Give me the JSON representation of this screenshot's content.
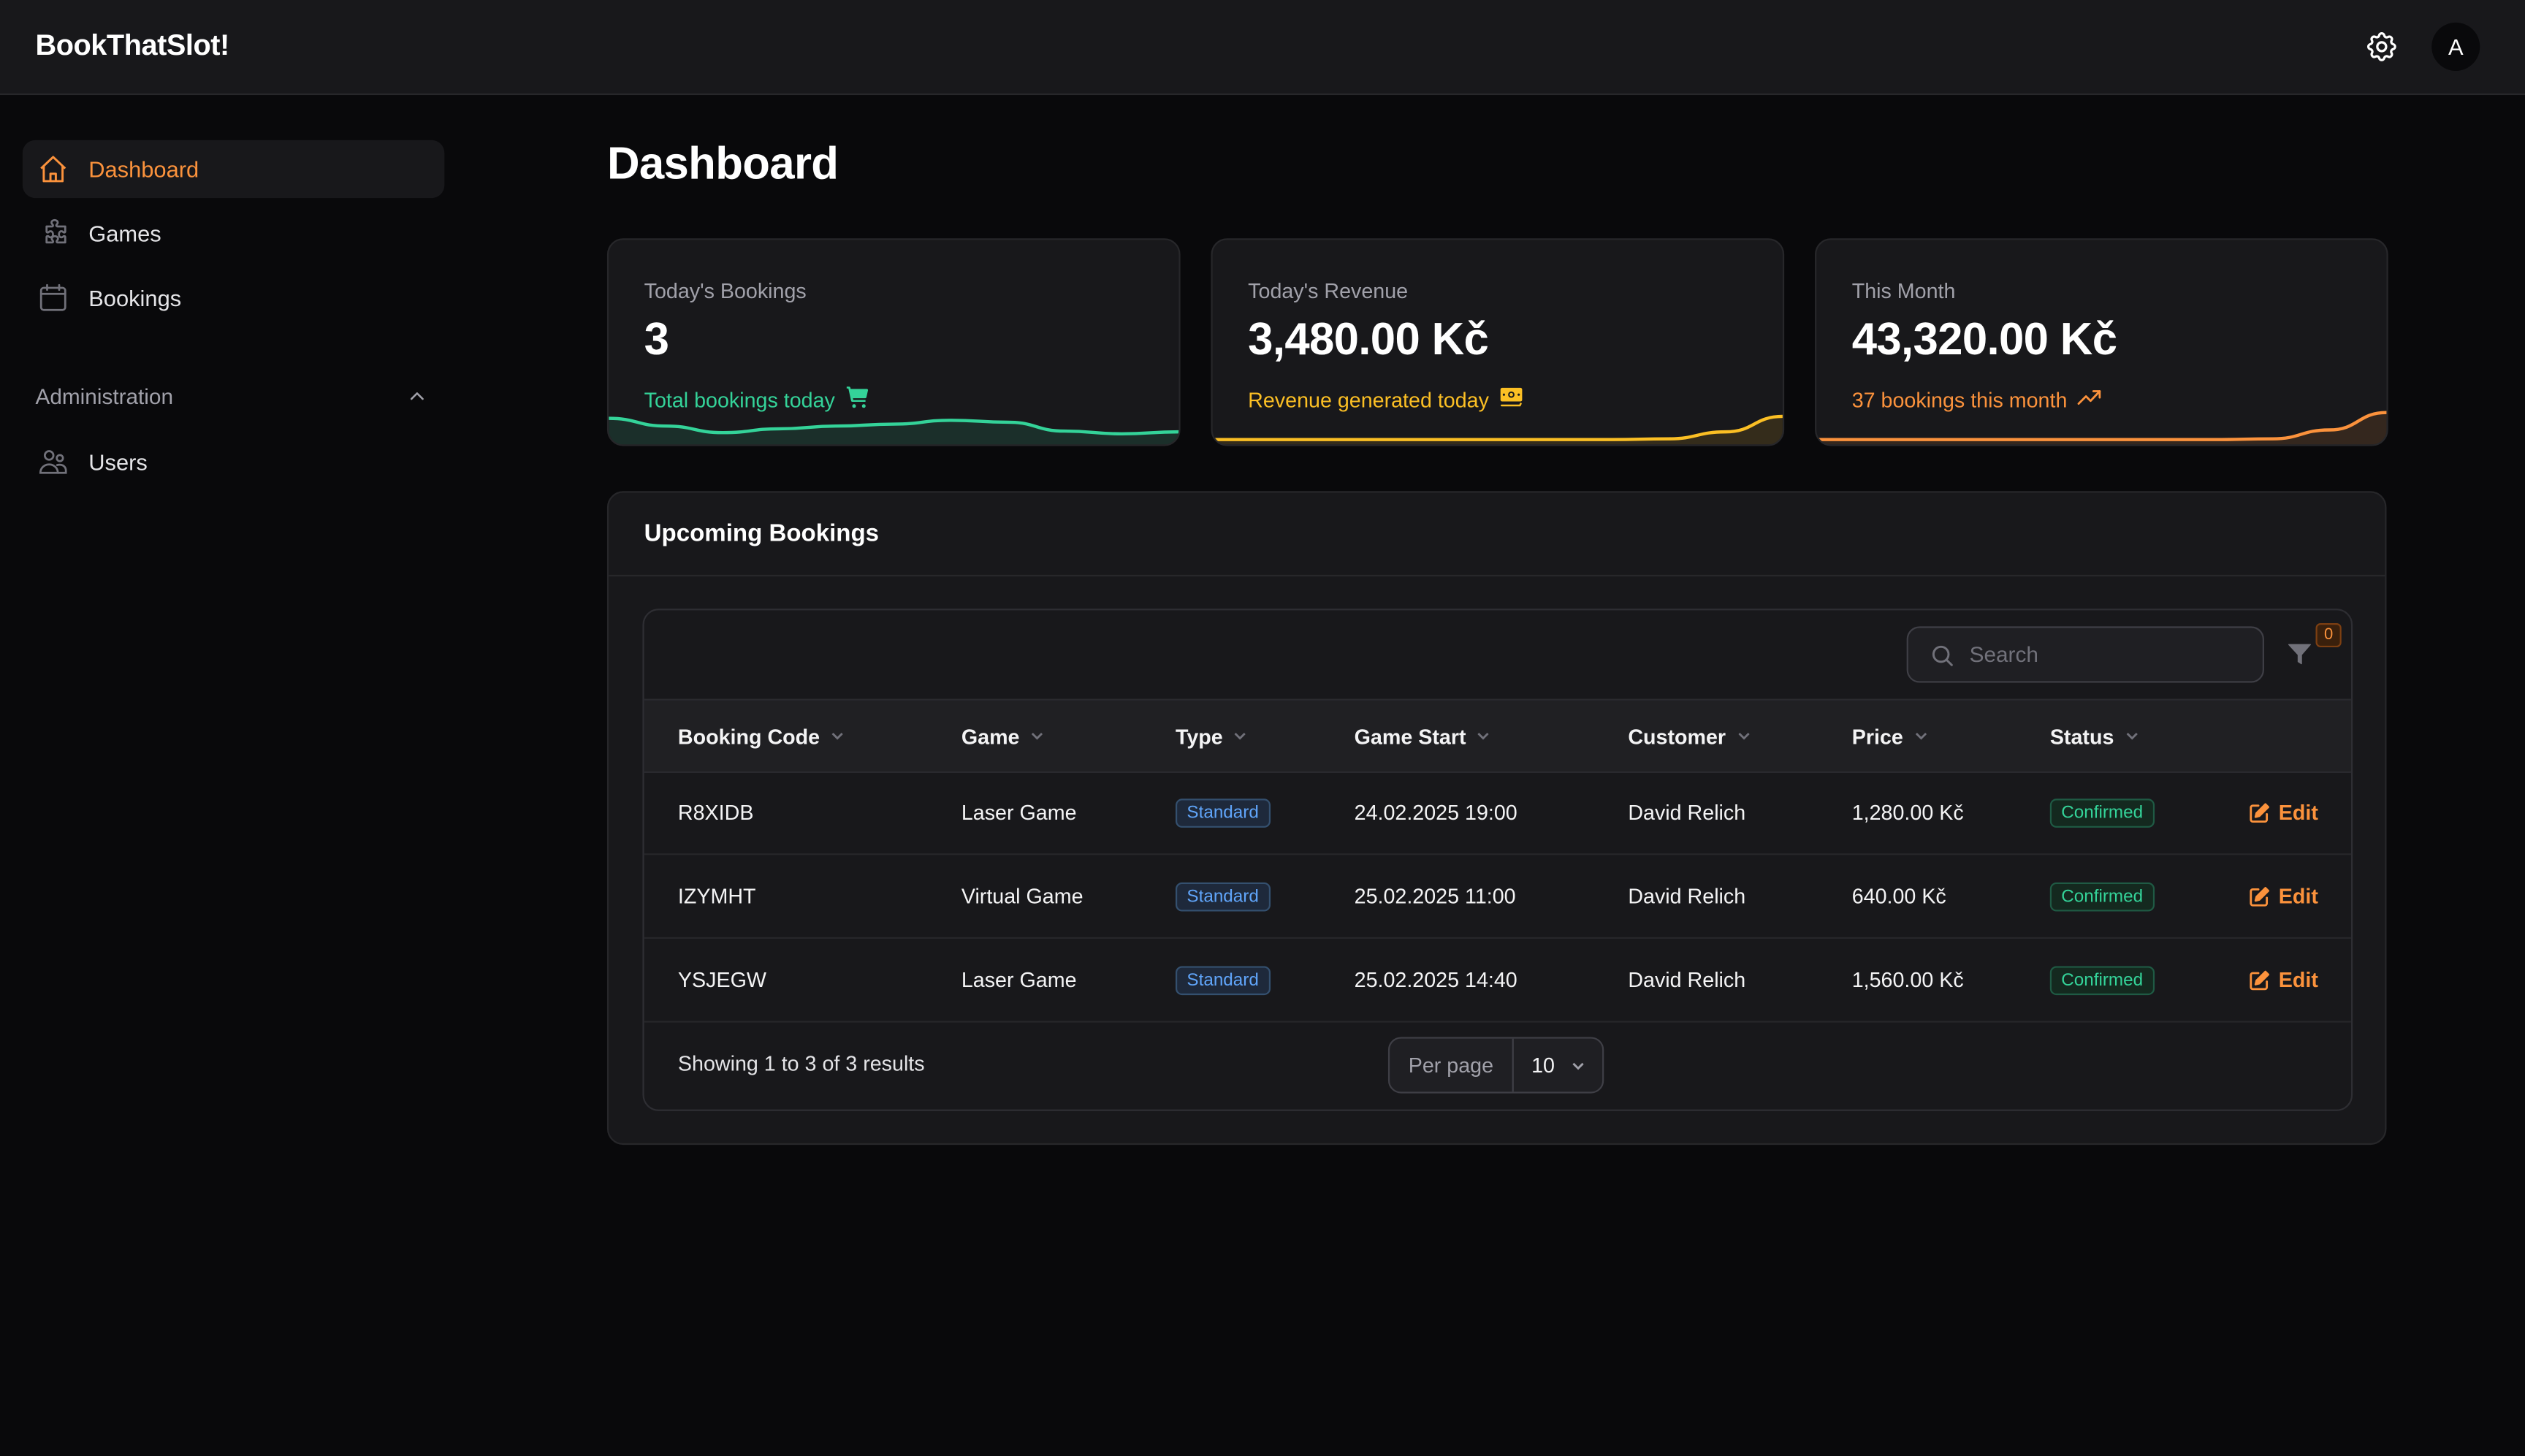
{
  "app": {
    "title": "BookThatSlot!",
    "settings_icon": "gear-icon",
    "avatar_initial": "A"
  },
  "sidebar": {
    "items": [
      {
        "label": "Dashboard",
        "icon": "home-icon",
        "active": true
      },
      {
        "label": "Games",
        "icon": "puzzle-icon",
        "active": false
      },
      {
        "label": "Bookings",
        "icon": "calendar-icon",
        "active": false
      }
    ],
    "section": {
      "label": "Administration",
      "expanded": true,
      "items": [
        {
          "label": "Users",
          "icon": "users-icon"
        }
      ]
    }
  },
  "page": {
    "title": "Dashboard"
  },
  "stats": [
    {
      "label": "Today's Bookings",
      "value": "3",
      "sub": "Total bookings today",
      "icon": "shopping-cart-icon",
      "color": "#34d399",
      "trend": [
        0.55,
        0.35,
        0.18,
        0.28,
        0.35,
        0.4,
        0.5,
        0.45,
        0.22,
        0.15,
        0.2
      ]
    },
    {
      "label": "Today's Revenue",
      "value": "3,480.00 Kč",
      "sub": "Revenue generated today",
      "icon": "banknotes-icon",
      "color": "#fbbf24",
      "trend": [
        0,
        0,
        0,
        0,
        0,
        0,
        0,
        0,
        0.02,
        0.2,
        0.6
      ]
    },
    {
      "label": "This Month",
      "value": "43,320.00 Kč",
      "sub": "37 bookings this month",
      "icon": "trending-up-icon",
      "color": "#fb923c",
      "trend": [
        0,
        0,
        0,
        0,
        0,
        0,
        0,
        0,
        0.02,
        0.25,
        0.7
      ]
    }
  ],
  "bookings": {
    "title": "Upcoming Bookings",
    "search": {
      "placeholder": "Search",
      "value": ""
    },
    "filter_count": "0",
    "columns": [
      "Booking Code",
      "Game",
      "Type",
      "Game Start",
      "Customer",
      "Price",
      "Status"
    ],
    "rows": [
      {
        "code": "R8XIDB",
        "game": "Laser Game",
        "type": "Standard",
        "start": "24.02.2025 19:00",
        "customer": "David Relich",
        "price": "1,280.00 Kč",
        "status": "Confirmed",
        "action": "Edit"
      },
      {
        "code": "IZYMHT",
        "game": "Virtual Game",
        "type": "Standard",
        "start": "25.02.2025 11:00",
        "customer": "David Relich",
        "price": "640.00 Kč",
        "status": "Confirmed",
        "action": "Edit"
      },
      {
        "code": "YSJEGW",
        "game": "Laser Game",
        "type": "Standard",
        "start": "25.02.2025 14:40",
        "customer": "David Relich",
        "price": "1,560.00 Kč",
        "status": "Confirmed",
        "action": "Edit"
      }
    ],
    "footer": {
      "summary": "Showing 1 to 3 of 3 results",
      "per_page_label": "Per page",
      "per_page_value": "10"
    }
  },
  "colors": {
    "accent": "#fb923c",
    "success": "#34d399",
    "info": "#60a5fa",
    "warning": "#fbbf24"
  }
}
